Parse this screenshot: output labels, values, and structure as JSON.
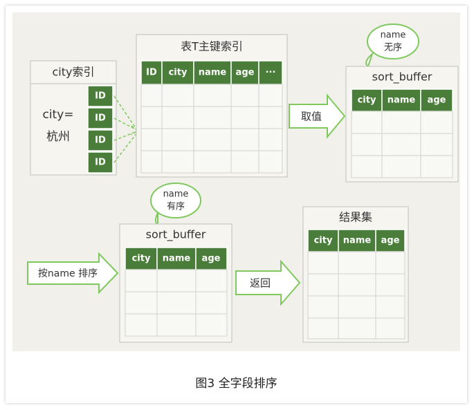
{
  "caption": "图3 全字段排序",
  "city_index": {
    "title": "city索引",
    "label_line1": "city=",
    "label_line2": "杭州",
    "ids": [
      "ID",
      "ID",
      "ID",
      "ID"
    ]
  },
  "pk_index": {
    "title": "表T主键索引",
    "columns": [
      "ID",
      "city",
      "name",
      "age",
      "···"
    ]
  },
  "fetch_arrow": {
    "label": "取值"
  },
  "sort_buffer_top": {
    "title": "sort_buffer",
    "bubble_line1": "name",
    "bubble_line2": "无序",
    "columns": [
      "city",
      "name",
      "age"
    ]
  },
  "sort_arrow": {
    "label": "按name 排序"
  },
  "sort_buffer_bottom": {
    "title": "sort_buffer",
    "bubble_line1": "name",
    "bubble_line2": "有序",
    "columns": [
      "city",
      "name",
      "age"
    ]
  },
  "return_arrow": {
    "label": "返回"
  },
  "result_set": {
    "title": "结果集",
    "columns": [
      "city",
      "name",
      "age"
    ]
  },
  "colors": {
    "header_green": "#4b7d3a",
    "arrow_green": "#7ec85d",
    "canvas_bg": "#f1f0ea"
  }
}
